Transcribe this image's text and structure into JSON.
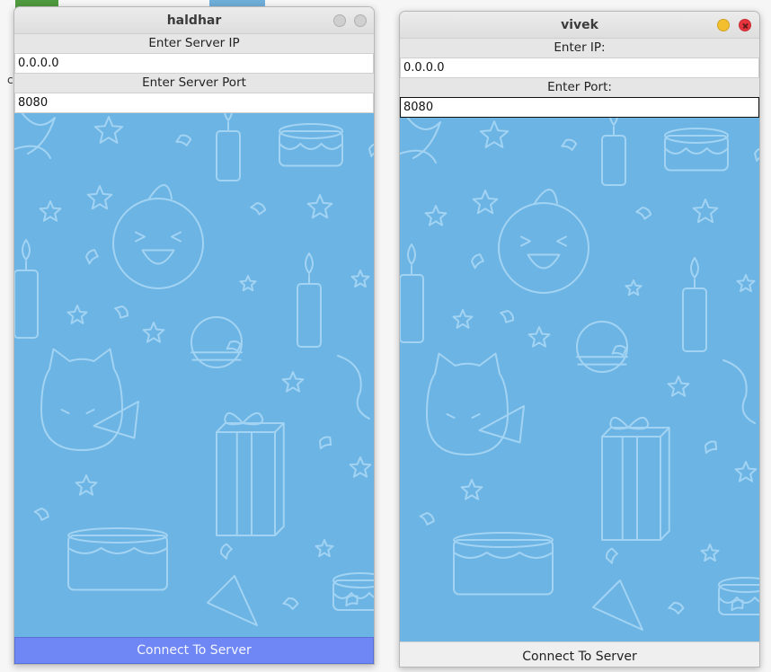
{
  "windows": {
    "left": {
      "title": "haldhar",
      "ip_label": "Enter Server IP",
      "ip_value": "0.0.0.0",
      "port_label": "Enter Server Port",
      "port_value": "8080",
      "connect_label": "Connect To Server"
    },
    "right": {
      "title": "vivek",
      "ip_label": "Enter IP:",
      "ip_value": "0.0.0.0",
      "port_label": "Enter Port:",
      "port_value": "8080",
      "connect_label": "Connect To Server"
    }
  },
  "background_remnant_char": "c",
  "colors": {
    "canvas_bg": "#6cb4e4",
    "doodle_stroke": "#9fd0f0",
    "pressed_button": "#6f87f5",
    "close_active": "#e8353d",
    "minimize_active": "#f4bf2e"
  },
  "icons": [
    "party-doodle-background",
    "close-icon",
    "minimize-icon"
  ]
}
